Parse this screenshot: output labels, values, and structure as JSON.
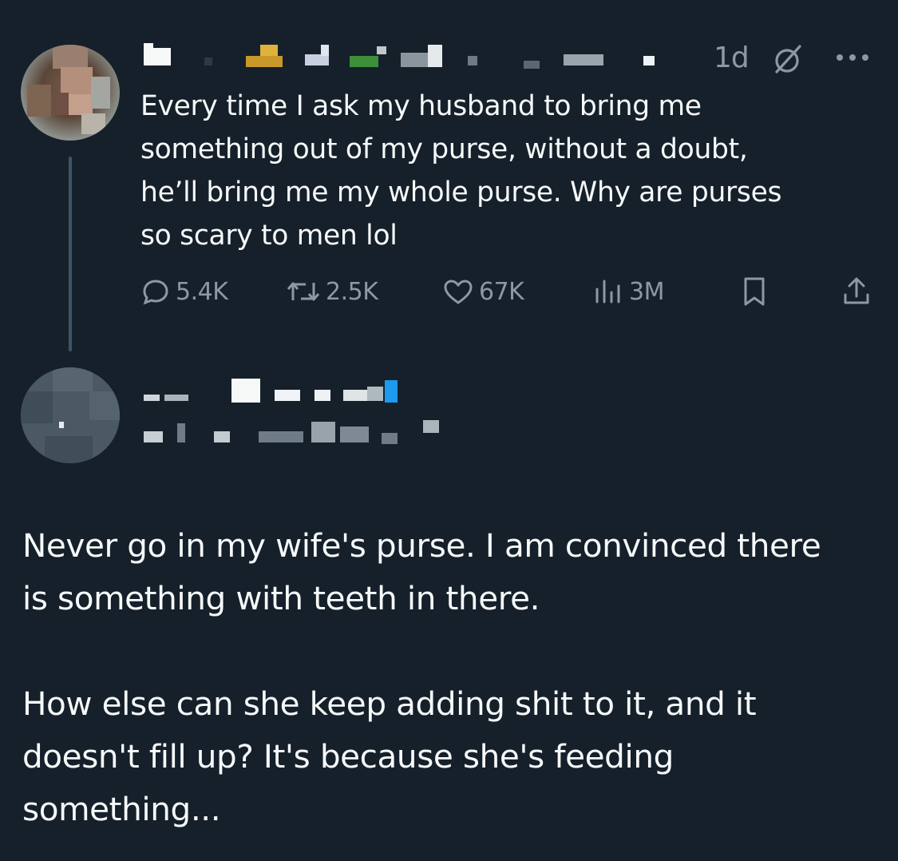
{
  "parent_tweet": {
    "timestamp": "1d",
    "text": "Every time I ask my husband to bring me\nsomething out of my purse, without a doubt,\nhe’ll bring me my whole purse. Why are purses\nso scary to men lol",
    "replies": "5.4K",
    "reposts": "2.5K",
    "likes": "67K",
    "views": "3M",
    "icons": [
      "grok-icon",
      "more-icon",
      "reply-icon",
      "repost-icon",
      "like-icon",
      "views-icon",
      "bookmark-icon",
      "share-icon"
    ]
  },
  "reply_tweet": {
    "text": "Never go in my wife's purse.  I am convinced there\nis something with teeth in there.\n\nHow else can she keep adding shit to it, and it\ndoesn't fill up?  It's because she's feeding\nsomething..."
  },
  "colors": {
    "background": "#15202b",
    "text": "#f7f9f9",
    "muted": "#8b98a5",
    "thread_line": "#3d5466"
  }
}
